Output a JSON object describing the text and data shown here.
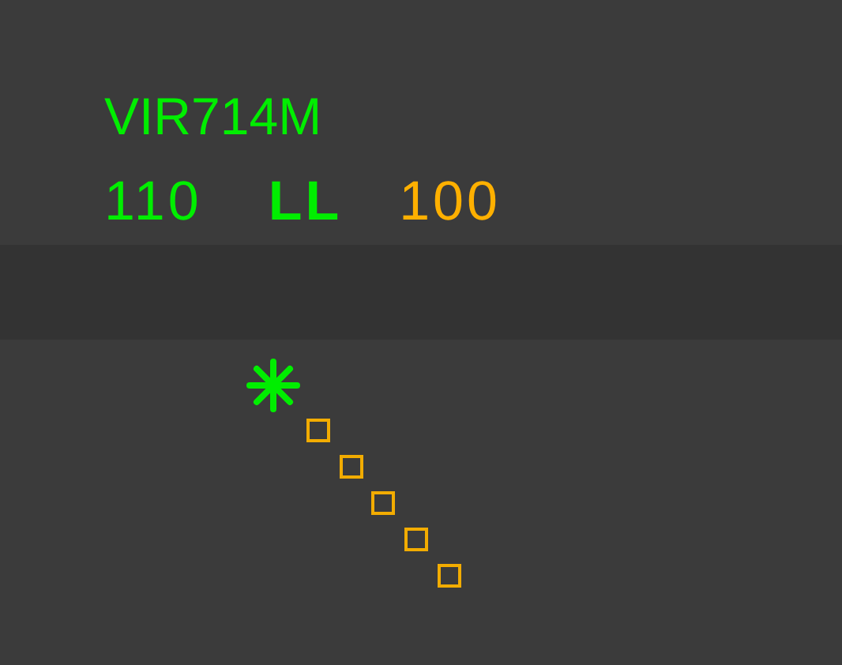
{
  "track_label": {
    "callsign": "VIR714M",
    "fields": [
      {
        "text": "110",
        "color": "#00ee00",
        "bold": false
      },
      {
        "text": "LL",
        "color": "#00ee00",
        "bold": true
      },
      {
        "text": "100",
        "color": "#ffb000",
        "bold": false
      }
    ]
  }
}
